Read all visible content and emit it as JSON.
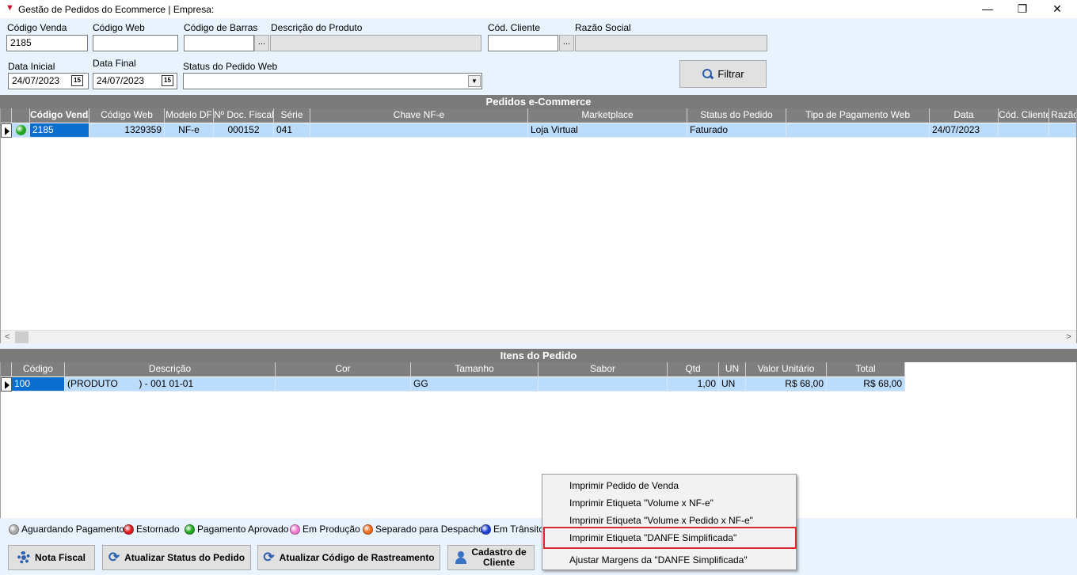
{
  "window": {
    "title": "Gestão de Pedidos do Ecommerce | Empresa:",
    "minimize": "—",
    "maximize": "❐",
    "close": "✕"
  },
  "filters": {
    "codigo_venda": {
      "label": "Código Venda",
      "value": "2185"
    },
    "codigo_web": {
      "label": "Código Web",
      "value": ""
    },
    "codigo_barras": {
      "label": "Código de Barras",
      "value": ""
    },
    "descricao_produto": {
      "label": "Descrição do Produto",
      "value": ""
    },
    "cod_cliente": {
      "label": "Cód. Cliente",
      "value": ""
    },
    "razao_social": {
      "label": "Razão Social",
      "value": ""
    },
    "data_inicial": {
      "label": "Data Inicial",
      "value": "24/07/2023"
    },
    "data_final": {
      "label": "Data Final",
      "value": "24/07/2023"
    },
    "status_pedido_web": {
      "label": "Status do Pedido Web",
      "value": ""
    },
    "dots_label": "...",
    "calendar_glyph": "15",
    "dropdown_glyph": "▼",
    "filter_button": "Filtrar"
  },
  "orders": {
    "title": "Pedidos e-Commerce",
    "columns": [
      "",
      "Código Venda",
      "Código Web",
      "Modelo DF",
      "Nº Doc. Fiscal",
      "Série",
      "Chave NF-e",
      "Marketplace",
      "Status do Pedido",
      "Tipo de Pagamento Web",
      "Data",
      "Cód. Cliente",
      "Razão"
    ],
    "rows": [
      {
        "status_color": "#1fa81f",
        "codigo_venda": "2185",
        "codigo_web": "1329359",
        "modelo_df": "NF-e",
        "doc_fiscal": "000152",
        "serie": "041",
        "chave_nfe": "",
        "marketplace": "Loja Virtual",
        "status": "Faturado",
        "tipo_pagamento": "",
        "data": "24/07/2023",
        "cod_cliente": "",
        "razao": ""
      }
    ]
  },
  "scroll": {
    "left": "<",
    "right": ">"
  },
  "items": {
    "title": "Itens do Pedido",
    "columns": [
      "Código",
      "Descrição",
      "Cor",
      "Tamanho",
      "Sabor",
      "Qtd",
      "UN",
      "Valor Unitário",
      "Total"
    ],
    "rows": [
      {
        "codigo": "100",
        "descricao": "(PRODUTO        ) - 001 01-01",
        "cor": "",
        "tamanho": "GG",
        "sabor": "",
        "qtd": "1,00",
        "un": "UN",
        "valor_unitario": "R$ 68,00",
        "total": "R$ 68,00"
      }
    ]
  },
  "legend": [
    {
      "label": "Aguardando Pagamento",
      "color": "#a8a8a8"
    },
    {
      "label": "Estornado",
      "color": "#e01818"
    },
    {
      "label": "Pagamento Aprovado",
      "color": "#1fa81f"
    },
    {
      "label": "Em Produção",
      "color": "#f07ad0"
    },
    {
      "label": "Separado para Despacho",
      "color": "#f26a1b"
    },
    {
      "label": "Em Trânsito",
      "color": "#1c3fd0"
    }
  ],
  "buttons": {
    "nota_fiscal": "Nota Fiscal",
    "atualizar_status": "Atualizar Status do Pedido",
    "atualizar_rastreamento": "Atualizar Código de Rastreamento",
    "cadastro_cliente_1": "Cadastro de",
    "cadastro_cliente_2": "Cliente"
  },
  "context_menu": {
    "items": [
      "Imprimir Pedido de Venda",
      "Imprimir Etiqueta \"Volume x NF-e\"",
      "Imprimir Etiqueta \"Volume x Pedido x NF-e\"",
      "Imprimir Etiqueta \"DANFE Simplificada\"",
      "Ajustar Margens da \"DANFE Simplificada\""
    ],
    "highlighted_index": 3
  }
}
